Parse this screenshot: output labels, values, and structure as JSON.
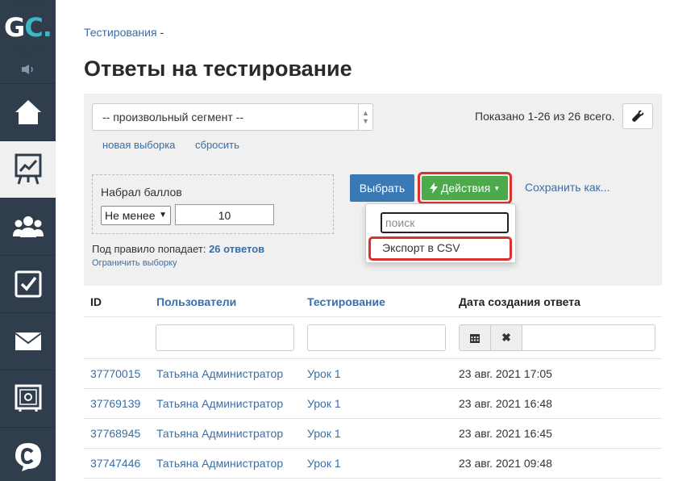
{
  "sidebar": {
    "logo": {
      "text_main": "G",
      "text_accent": "C."
    },
    "items": [
      {
        "icon": "home-icon",
        "active": false
      },
      {
        "icon": "chart-icon",
        "active": true
      },
      {
        "icon": "users-icon",
        "active": false
      },
      {
        "icon": "checkbox-icon",
        "active": false
      },
      {
        "icon": "mail-icon",
        "active": false
      },
      {
        "icon": "safe-icon",
        "active": false
      },
      {
        "icon": "chat-logo-icon",
        "active": false
      }
    ]
  },
  "breadcrumb": {
    "item": "Тестирования",
    "sep": " -"
  },
  "page_title": "Ответы на тестирование",
  "filter": {
    "segment_value": "-- произвольный сегмент --",
    "shown": "Показано 1-26 из 26 всего.",
    "new_selection": "новая выборка",
    "reset": "сбросить",
    "score_label": "Набрал баллов",
    "score_operator": "Не менее",
    "score_value": "10",
    "rule_prefix": "Под правило попадает:",
    "rule_count": "26 ответов",
    "limit_link": "Ограничить выборку"
  },
  "buttons": {
    "select": "Выбрать",
    "actions": "Действия",
    "save_as": "Сохранить как..."
  },
  "dropdown": {
    "search_placeholder": "поиск",
    "export": "Экспорт в CSV"
  },
  "table": {
    "headers": [
      "ID",
      "Пользователи",
      "Тестирование",
      "Дата создания ответа"
    ],
    "rows": [
      {
        "id": "37770015",
        "user": "Татьяна Администратор",
        "test": "Урок 1",
        "date": "23 авг. 2021 17:05"
      },
      {
        "id": "37769139",
        "user": "Татьяна Администратор",
        "test": "Урок 1",
        "date": "23 авг. 2021 16:48"
      },
      {
        "id": "37768945",
        "user": "Татьяна Администратор",
        "test": "Урок 1",
        "date": "23 авг. 2021 16:45"
      },
      {
        "id": "37747446",
        "user": "Татьяна Администратор",
        "test": "Урок 1",
        "date": "23 авг. 2021 09:48"
      }
    ]
  }
}
